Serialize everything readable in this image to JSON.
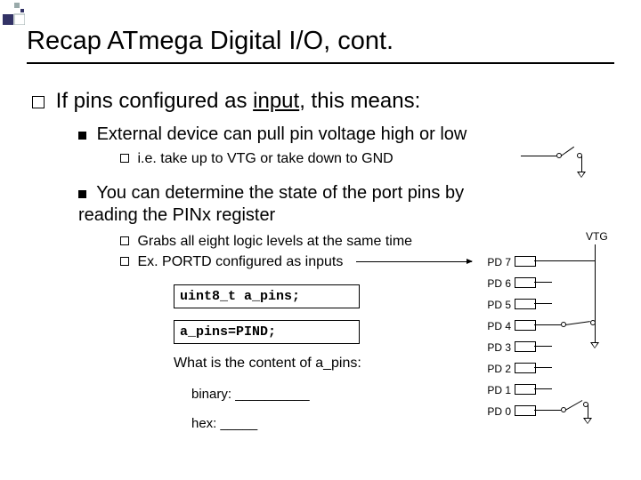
{
  "title": "Recap ATmega Digital I/O, cont.",
  "bullet1_pre": "If pins configured as ",
  "bullet1_u": "input",
  "bullet1_post": ", this means:",
  "b1a": "External device can pull pin voltage high or low",
  "b1a1": "i.e. take up to VTG or take down to GND",
  "b1b": "You can determine the state of the port pins by reading the PINx register",
  "b1b1": "Grabs all eight logic levels at the same time",
  "b1b2": "Ex. PORTD configured as inputs",
  "code1": "uint8_t a_pins;",
  "code2": "a_pins=PIND;",
  "q": "What is the content of a_pins:",
  "ans_bin": "binary: __________",
  "ans_hex": "hex: _____",
  "vtg": "VTG",
  "pins": [
    "PD 7",
    "PD 6",
    "PD 5",
    "PD 4",
    "PD 3",
    "PD 2",
    "PD 1",
    "PD 0"
  ]
}
